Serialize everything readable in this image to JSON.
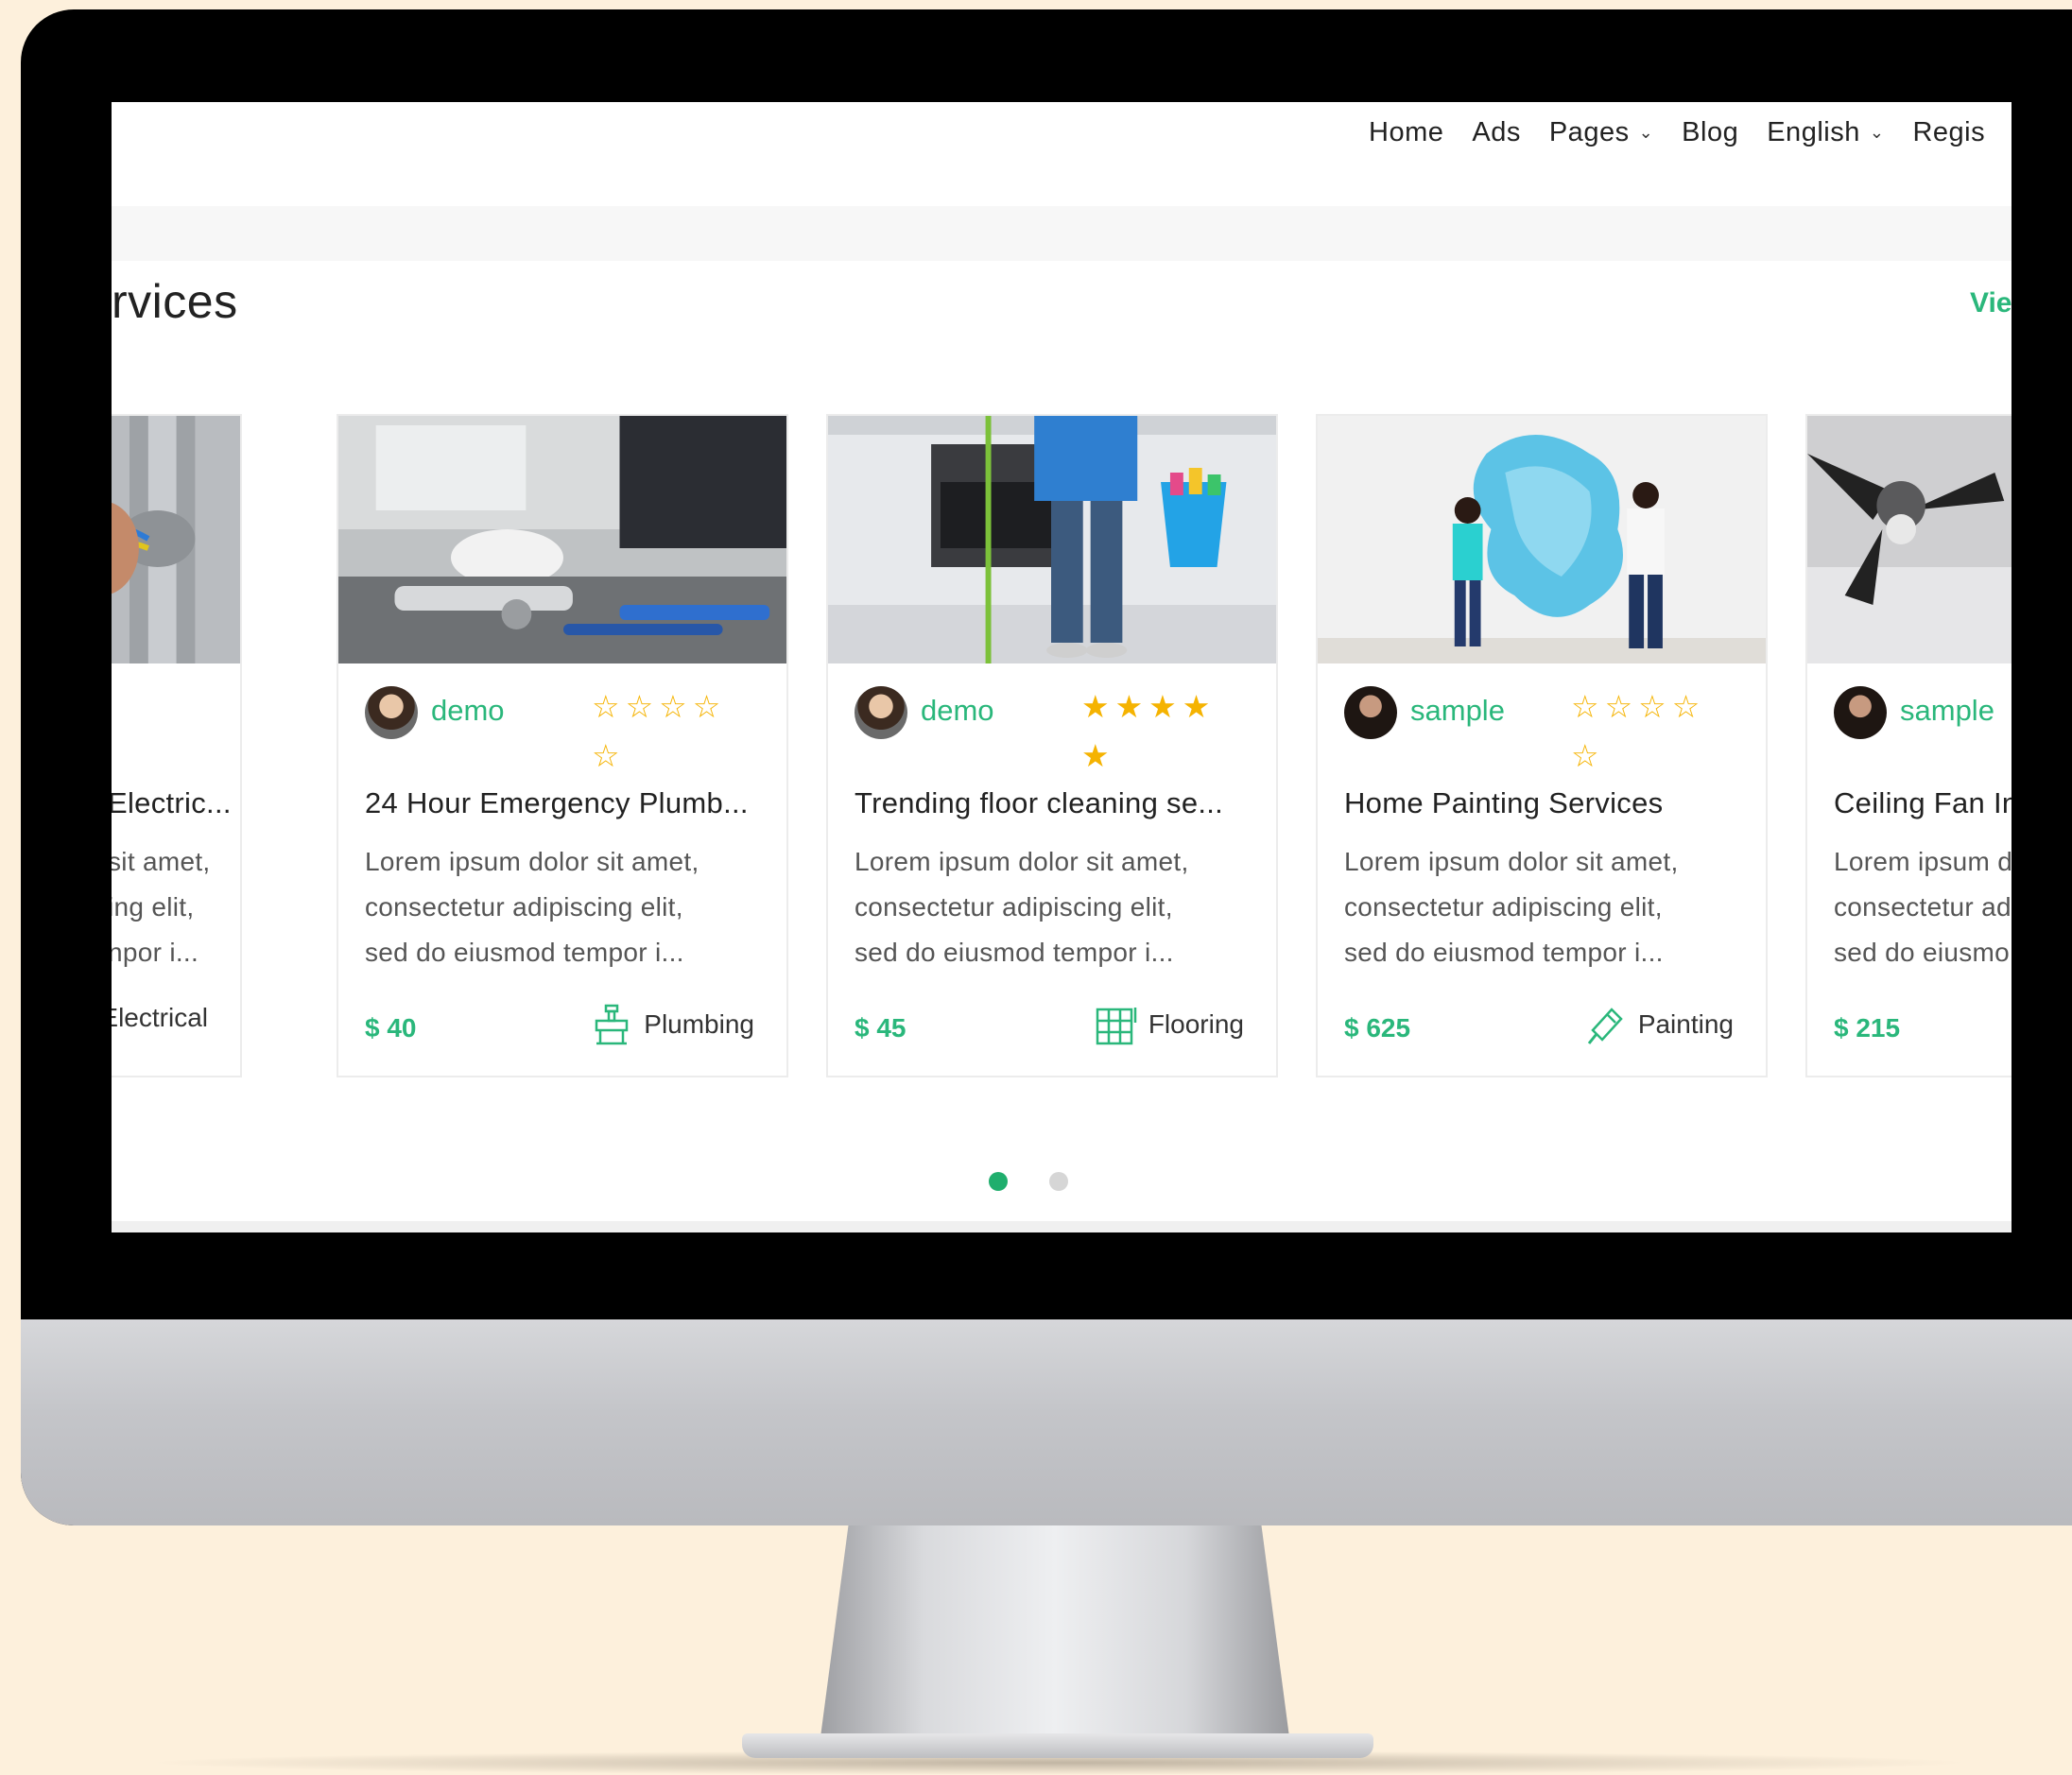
{
  "nav": {
    "items": [
      {
        "label": "Home",
        "has_dropdown": false
      },
      {
        "label": "Ads",
        "has_dropdown": false
      },
      {
        "label": "Pages",
        "has_dropdown": true
      },
      {
        "label": "Blog",
        "has_dropdown": false
      },
      {
        "label": "English",
        "has_dropdown": true
      },
      {
        "label": "Regis",
        "has_dropdown": false
      }
    ]
  },
  "section": {
    "title": "rvices",
    "view_all": "Vie"
  },
  "cards": [
    {
      "author": "",
      "stars": "☆☆☆",
      "title": "Electric...",
      "desc": [
        "sit amet,",
        "ing elit,",
        "npor i..."
      ],
      "price": "",
      "category": "Electrical",
      "category_icon": "electrical-icon"
    },
    {
      "author": "demo",
      "stars": "☆☆☆☆☆",
      "title": "24 Hour Emergency Plumb...",
      "desc": [
        "Lorem ipsum dolor sit amet,",
        "consectetur adipiscing elit,",
        "sed do eiusmod tempor i..."
      ],
      "price": "$ 40",
      "category": "Plumbing",
      "category_icon": "plumbing-icon"
    },
    {
      "author": "demo",
      "stars": "★★★★★",
      "title": "Trending floor cleaning se...",
      "desc": [
        "Lorem ipsum dolor sit amet,",
        "consectetur adipiscing elit,",
        "sed do eiusmod tempor i..."
      ],
      "price": "$ 45",
      "category": "Flooring",
      "category_icon": "flooring-icon"
    },
    {
      "author": "sample",
      "stars": "☆☆☆☆☆",
      "title": "Home Painting Services",
      "desc": [
        "Lorem ipsum dolor sit amet,",
        "consectetur adipiscing elit,",
        "sed do eiusmod tempor i..."
      ],
      "price": "$ 625",
      "category": "Painting",
      "category_icon": "painting-icon"
    },
    {
      "author": "sample",
      "stars": "",
      "title": "Ceiling Fan Ins",
      "desc": [
        "Lorem ipsum d",
        "consectetur ad",
        "sed do eiusmo"
      ],
      "price": "$ 215",
      "category": "",
      "category_icon": ""
    }
  ],
  "carousel": {
    "pages": 2,
    "active": 0
  },
  "colors": {
    "accent": "#2ab77b",
    "star": "#f5b301",
    "background": "#fdf0dc"
  }
}
